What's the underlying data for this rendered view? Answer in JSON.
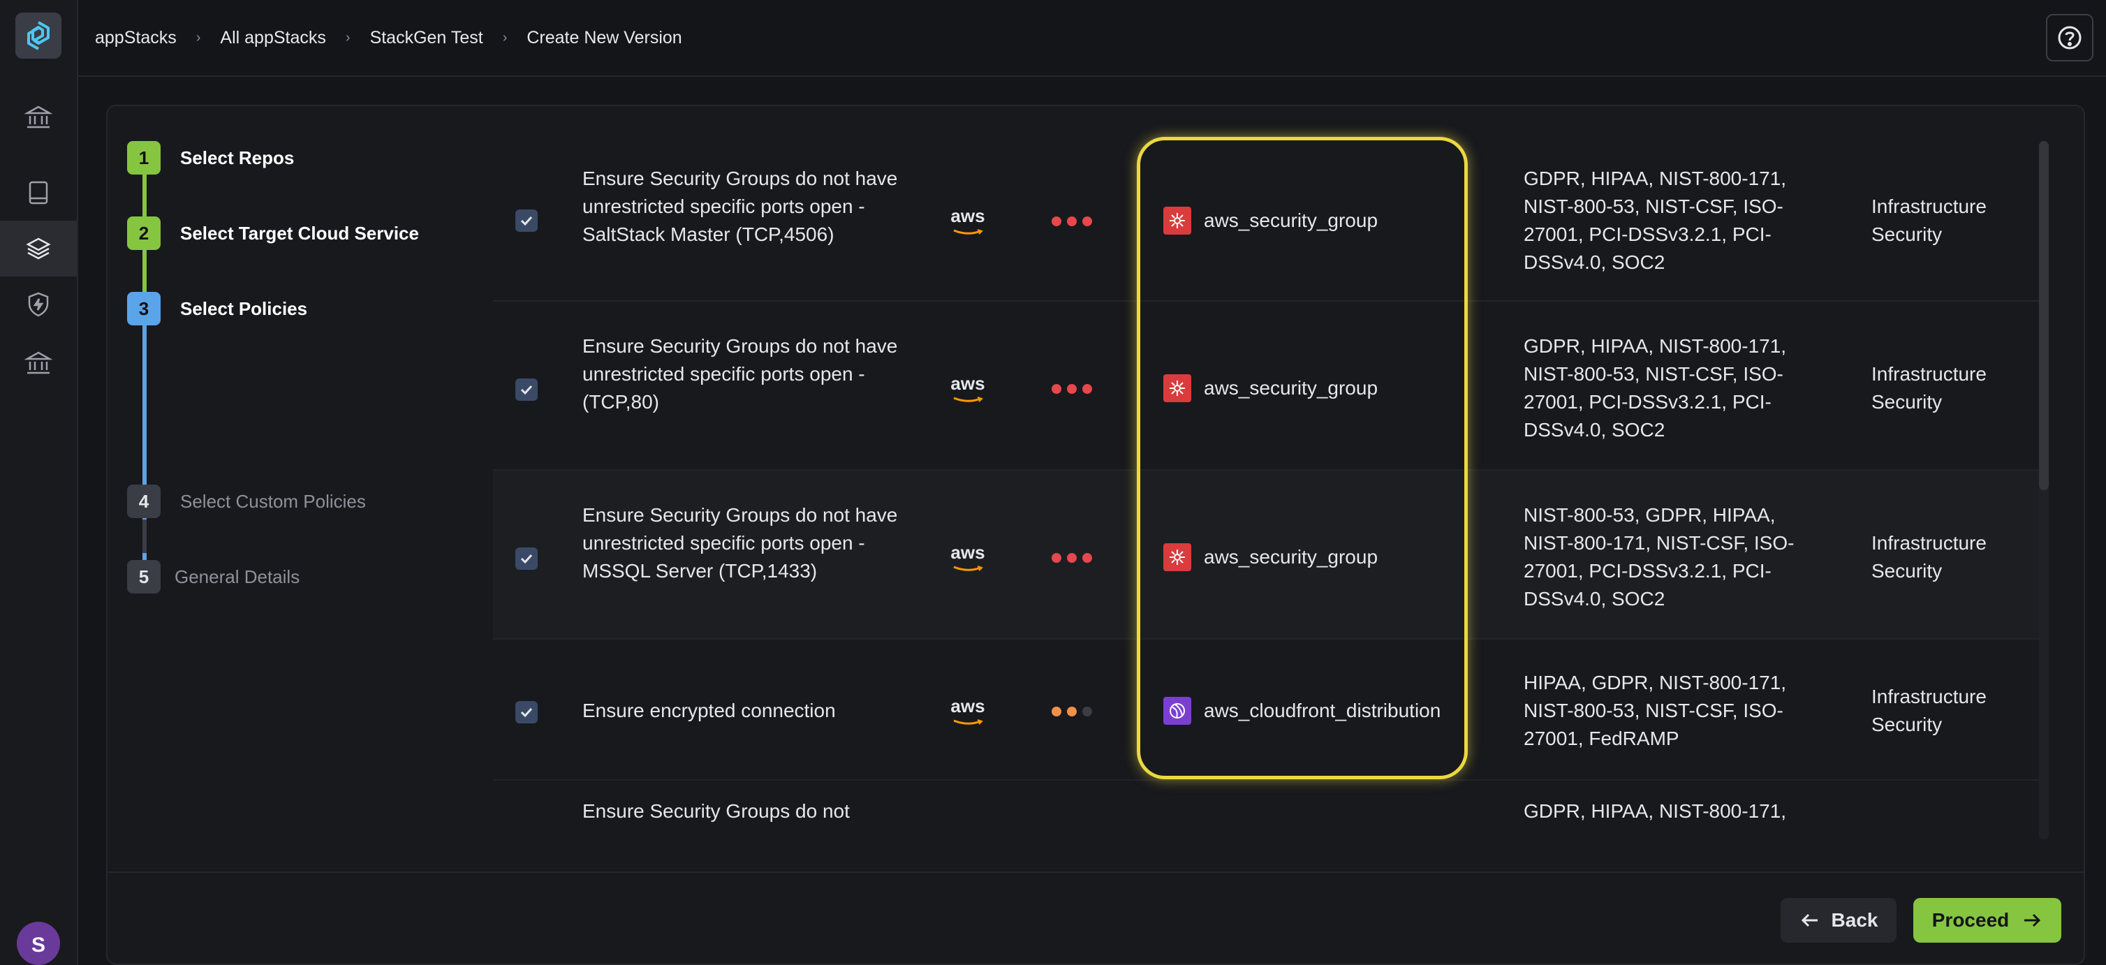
{
  "breadcrumb": [
    "appStacks",
    "All appStacks",
    "StackGen Test",
    "Create New Version"
  ],
  "avatar_initial": "S",
  "steps": [
    {
      "num": "1",
      "label": "Select Repos",
      "state": "done"
    },
    {
      "num": "2",
      "label": "Select Target Cloud Service",
      "state": "done"
    },
    {
      "num": "3",
      "label": "Select Policies",
      "state": "active"
    },
    {
      "num": "4",
      "label": "Select Custom Policies",
      "state": "pending"
    },
    {
      "num": "5",
      "label": "General Details",
      "state": "pending"
    }
  ],
  "colors": {
    "done": "#86c540",
    "active": "#5aa4ea",
    "pending": "#3a3d45",
    "high": "#e5484d",
    "medium": "#f0904a",
    "highlight": "#ebd840"
  },
  "rows": [
    {
      "checked": true,
      "title": "Ensure Security Groups do not have unrestricted specific ports open - SaltStack Master (TCP,4506)",
      "provider": "aws",
      "severity": [
        "high",
        "high",
        "high"
      ],
      "resource": "aws_security_group",
      "resource_icon": "security-group-icon",
      "compliance": "GDPR, HIPAA, NIST-800-171, NIST-800-53, NIST-CSF, ISO-27001, PCI-DSSv3.2.1, PCI-DSSv4.0, SOC2",
      "category": "Infrastructure Security"
    },
    {
      "checked": true,
      "title": "Ensure Security Groups do not have unrestricted specific ports open - (TCP,80)",
      "provider": "aws",
      "severity": [
        "high",
        "high",
        "high"
      ],
      "resource": "aws_security_group",
      "resource_icon": "security-group-icon",
      "compliance": "GDPR, HIPAA, NIST-800-171, NIST-800-53, NIST-CSF, ISO-27001, PCI-DSSv3.2.1, PCI-DSSv4.0, SOC2",
      "category": "Infrastructure Security"
    },
    {
      "checked": true,
      "title": "Ensure Security Groups do not have unrestricted specific ports open - MSSQL Server (TCP,1433)",
      "provider": "aws",
      "severity": [
        "high",
        "high",
        "high"
      ],
      "resource": "aws_security_group",
      "resource_icon": "security-group-icon",
      "compliance": "NIST-800-53, GDPR, HIPAA, NIST-800-171, NIST-CSF, ISO-27001, PCI-DSSv3.2.1, PCI-DSSv4.0, SOC2",
      "category": "Infrastructure Security"
    },
    {
      "checked": true,
      "title": "Ensure encrypted connection",
      "provider": "aws",
      "severity": [
        "medium",
        "medium",
        "low"
      ],
      "resource": "aws_cloudfront_distribution",
      "resource_icon": "cloudfront-icon",
      "compliance": "HIPAA, GDPR, NIST-800-171, NIST-800-53, NIST-CSF, ISO-27001, FedRAMP",
      "category": "Infrastructure Security"
    },
    {
      "checked": false,
      "title": "Ensure Security Groups do not",
      "compliance": "GDPR, HIPAA, NIST-800-171,"
    }
  ],
  "buttons": {
    "back": "Back",
    "proceed": "Proceed"
  }
}
